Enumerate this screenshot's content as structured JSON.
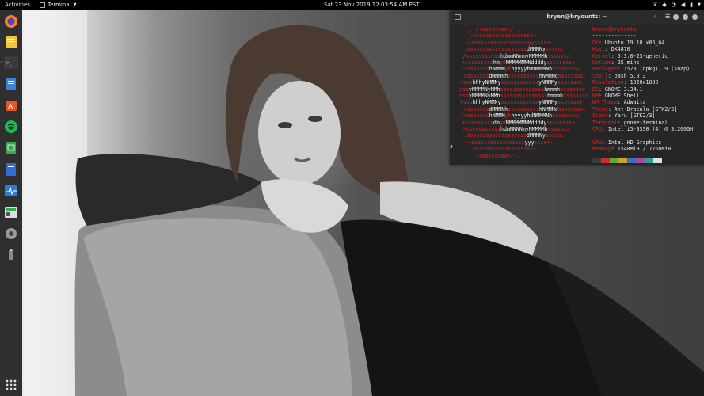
{
  "topbar": {
    "activities": "Activities",
    "app_name": "Terminal",
    "clock": "Sat 23 Nov 2019 12:03:54 AM PST"
  },
  "dock": {
    "items": [
      "firefox-icon",
      "notes-icon",
      "terminal-icon",
      "text-editor-icon",
      "software-center-icon",
      "spotify-icon",
      "spreadsheet-icon",
      "document-icon",
      "system-monitor-icon",
      "settings-app-icon",
      "settings-gear-icon",
      "usb-drive-icon"
    ],
    "show_apps_icon": "grid-icon"
  },
  "terminal": {
    "title": "bryen@bryounts: ~",
    "logo": [
      {
        "r": ".-/+oossssoo+/-.",
        "w": "",
        "r2": ""
      },
      {
        "r": "`:+ssssssssssssssssss+:`",
        "w": "",
        "r2": ""
      },
      {
        "r": "-+ssssssssssssssssssyyssss+-",
        "w": "",
        "r2": ""
      },
      {
        "r": ".ossssssssssssssssss",
        "w": "dMMMNy",
        "r2": "sssso."
      },
      {
        "r": "/sssssssssss",
        "w": "hdmmNNmmyNMMMMh",
        "r2": "ssssss/"
      },
      {
        "r": "+sssssssss",
        "w": "hm",
        "r2": "yd",
        "w2": "MMMMMMMNddddy",
        "r3": "ssssssss+"
      },
      {
        "r": "/ssssssss",
        "w": "hNMMM",
        "r2": "yh",
        "w2": "hyyyyhmNMMMNh",
        "r3": "ssssssss/"
      },
      {
        "r": ".ssssssss",
        "w": "dMMMNh",
        "r2": "ssssssssss",
        "w2": "hNMMMd",
        "r3": "ssssssss."
      },
      {
        "r": "+sss",
        "w": "hhhyNMMNy",
        "r2": "ssssssssssss",
        "w2": "yNMMMy",
        "r3": "sssssss+"
      },
      {
        "r": "oss",
        "w": "yNMMMNyMMh",
        "r2": "ssssssssssssss",
        "w2": "hmmmh",
        "r3": "ssssssso"
      },
      {
        "r": "oss",
        "w": "yNMMMNyMMh",
        "r2": "sssssssssssssss",
        "w2": "hmmmh",
        "r3": "ssssssso"
      },
      {
        "r": "+sss",
        "w": "hhhyNMMNy",
        "r2": "ssssssssssss",
        "w2": "yNMMMy",
        "r3": "sssssss+"
      },
      {
        "r": ".ssssssss",
        "w": "dMMMNh",
        "r2": "ssssssssss",
        "w2": "hNMMMd",
        "r3": "ssssssss."
      },
      {
        "r": "/ssssssss",
        "w": "hNMMM",
        "r2": "yh",
        "w2": "hyyyyhdNMMMNh",
        "r3": "ssssssss/"
      },
      {
        "r": "+sssssssss",
        "w": "dm",
        "r2": "yd",
        "w2": "MMMMMMMMddddy",
        "r3": "ssssssss+"
      },
      {
        "r": "/sssssssssss",
        "w": "hdmNNNNmyNMMMMh",
        "r2": "ssssss/"
      },
      {
        "r": ".ossssssssssssssssss",
        "w": "dMMMNy",
        "r2": "sssso."
      },
      {
        "r": "-+sssssssssssssssss",
        "w": "yyy",
        "r2": "ssss+-"
      },
      {
        "r": "`:+ssssssssssssssssss+:`",
        "w": "",
        "r2": ""
      },
      {
        "r": ".-/+oossssoo+/-.",
        "w": "",
        "r2": ""
      }
    ],
    "cursor_line": "z",
    "info": [
      {
        "k": "bryen",
        "v": "@bryounts",
        "user": true
      },
      {
        "k": "",
        "v": "--------------"
      },
      {
        "k": "OS",
        "v": ": Ubuntu 19.10 x86_64"
      },
      {
        "k": "Host",
        "v": ": DX4870"
      },
      {
        "k": "Kernel",
        "v": ": 5.3.0-23-generic"
      },
      {
        "k": "Uptime",
        "v": ": 25 mins"
      },
      {
        "k": "Packages",
        "v": ": 1578 (dpkg), 9 (snap)"
      },
      {
        "k": "Shell",
        "v": ": bash 5.0.3"
      },
      {
        "k": "Resolution",
        "v": ": 1920x1080"
      },
      {
        "k": "DE",
        "v": ": GNOME 3.34.1"
      },
      {
        "k": "WM",
        "v": ": GNOME Shell"
      },
      {
        "k": "WM Theme",
        "v": ": Adwaita"
      },
      {
        "k": "Theme",
        "v": ": Ant-Dracula [GTK2/3]"
      },
      {
        "k": "Icons",
        "v": ": Yaru [GTK2/3]"
      },
      {
        "k": "Terminal",
        "v": ": gnome-terminal"
      },
      {
        "k": "CPU",
        "v": ": Intel i5-3330 (4) @ 3.200GH"
      },
      {
        "k": "",
        "v": ""
      },
      {
        "k": "GPU",
        "v": ": Intel HD Graphics"
      },
      {
        "k": "Memory",
        "v": ": 1548MiB / 7768MiB"
      }
    ],
    "swatches": [
      "#3a3a3a",
      "#d1282b",
      "#5fa832",
      "#c9a227",
      "#3b6fb6",
      "#9b4fa6",
      "#2aa198",
      "#e0e0e0"
    ]
  }
}
